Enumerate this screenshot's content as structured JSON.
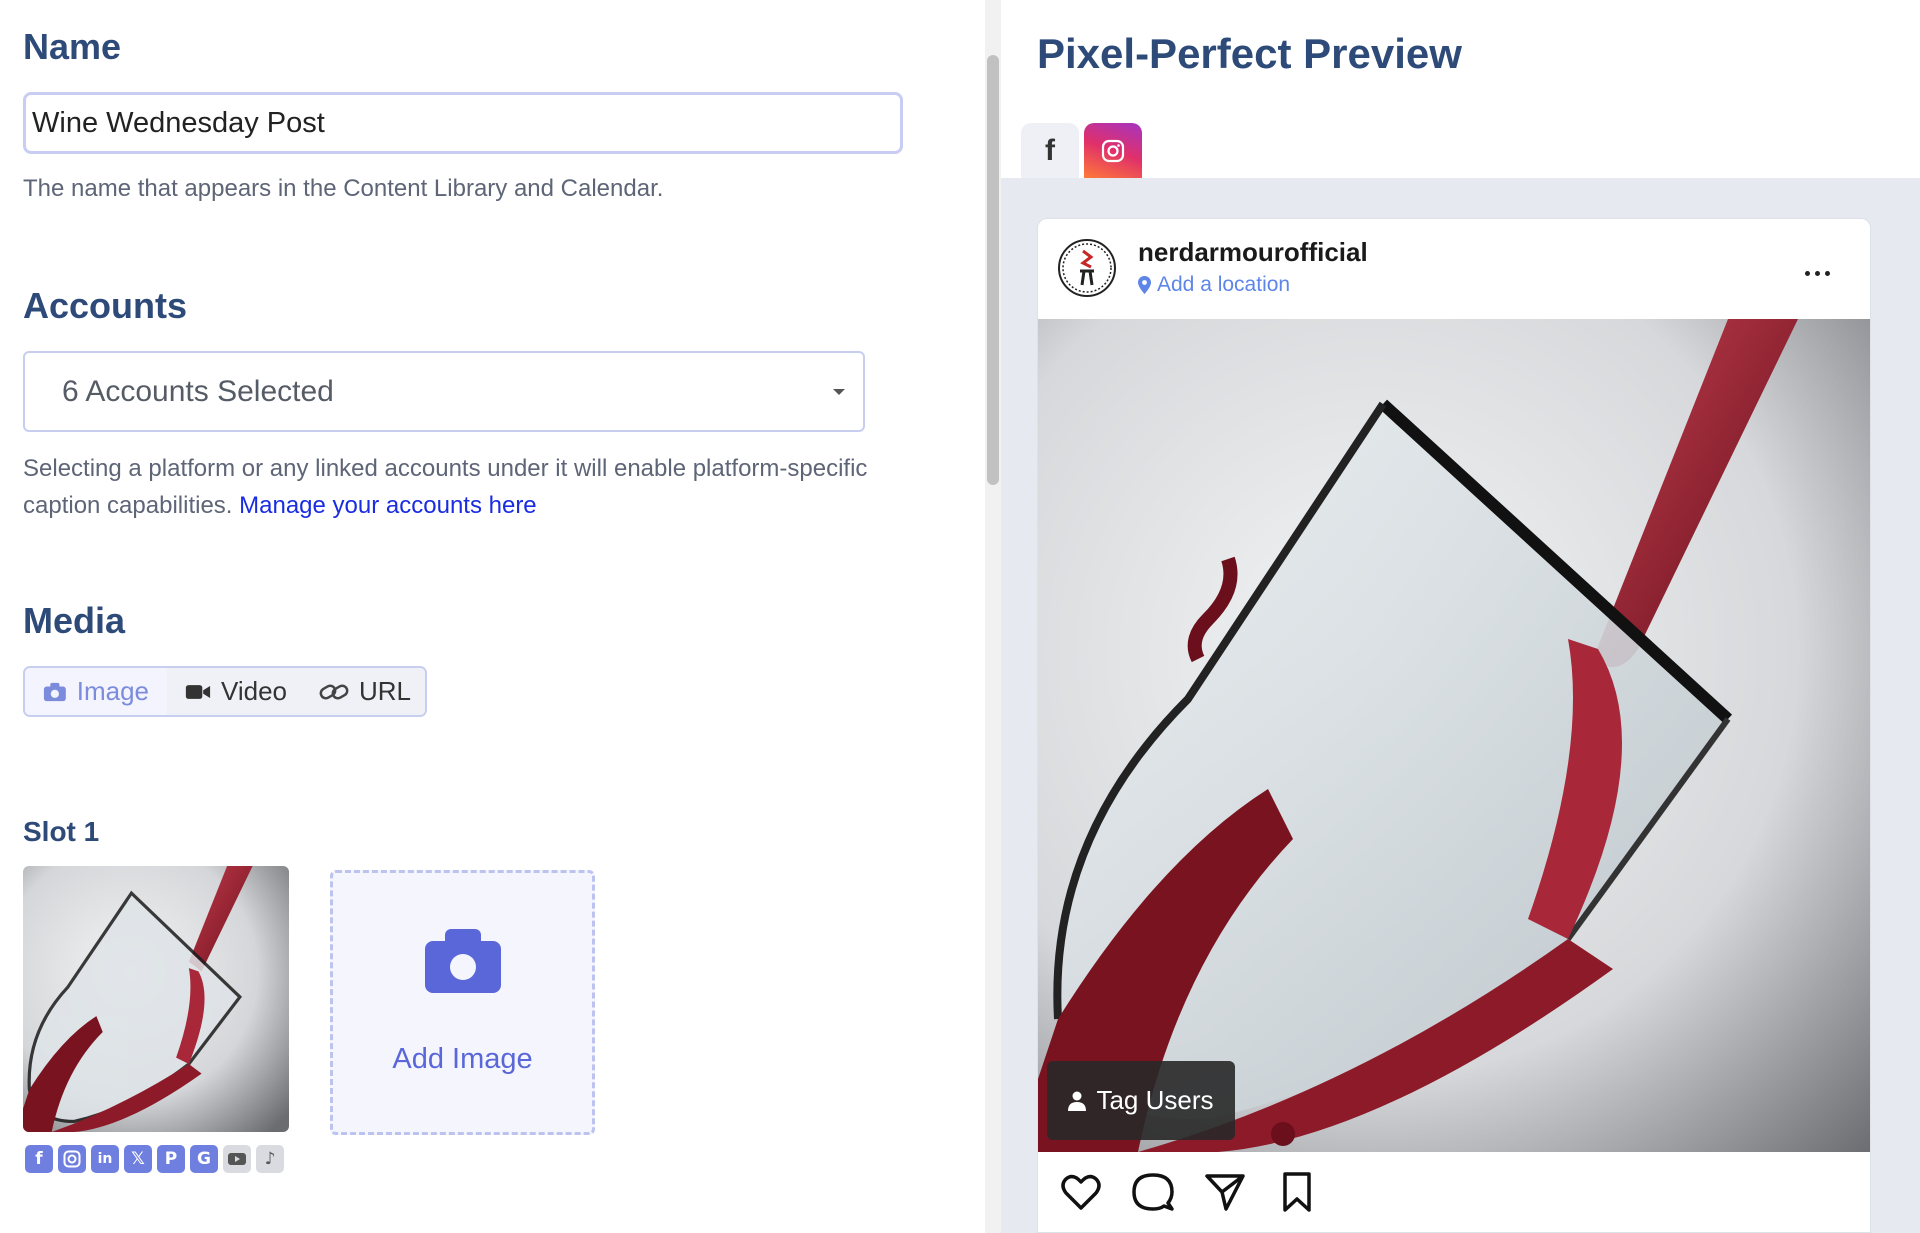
{
  "name_section": {
    "title": "Name",
    "input_value": "Wine Wednesday Post",
    "help": "The name that appears in the Content Library and Calendar."
  },
  "accounts_section": {
    "title": "Accounts",
    "selected": "6 Accounts Selected",
    "help": "Selecting a platform or any linked accounts under it will enable platform-specific caption capabilities. ",
    "link": "Manage your accounts here"
  },
  "media_section": {
    "title": "Media",
    "tabs": [
      {
        "label": "Image",
        "icon": "camera-icon",
        "active": true
      },
      {
        "label": "Video",
        "icon": "video-icon",
        "active": false
      },
      {
        "label": "URL",
        "icon": "link-icon",
        "active": false
      }
    ],
    "slot_label": "Slot 1",
    "add_image_label": "Add Image",
    "platforms": [
      "facebook-icon",
      "instagram-icon",
      "linkedin-icon",
      "x-icon",
      "pinterest-icon",
      "google-icon",
      "youtube-icon",
      "tiktok-icon"
    ]
  },
  "preview": {
    "title": "Pixel-Perfect Preview",
    "tabs": [
      "facebook-icon",
      "instagram-icon"
    ],
    "active_tab": "instagram",
    "username": "nerdarmourofficial",
    "location": "Add a location",
    "tag_users": "Tag Users"
  },
  "colors": {
    "heading": "#2d4a78",
    "accent": "#5a67d8",
    "link": "#1a2ce0",
    "preview_bg": "#e6e9ef"
  }
}
